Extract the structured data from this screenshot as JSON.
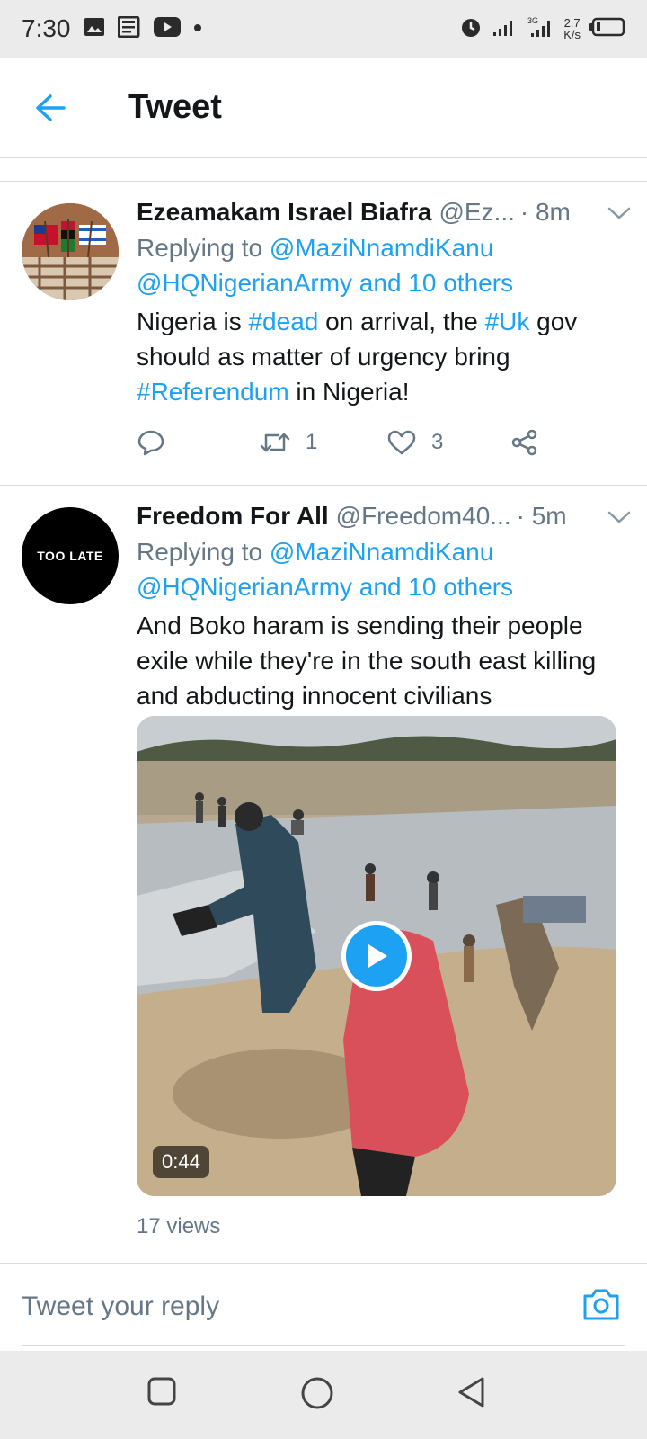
{
  "status_bar": {
    "time": "7:30",
    "net_speed_value": "2.7",
    "net_speed_unit": "K/s",
    "icons": [
      "image-icon",
      "news-icon",
      "youtube-icon",
      "dot-icon",
      "alarm-icon",
      "signal-icon",
      "signal-3g-icon",
      "battery-icon"
    ]
  },
  "header": {
    "title": "Tweet",
    "back_icon": "arrow-left-icon"
  },
  "colors": {
    "accent": "#1da1f2",
    "text_primary": "#14171a",
    "text_secondary": "#657786",
    "divider": "#d8dde2",
    "system_bar": "#ebebeb"
  },
  "tweets": [
    {
      "name": "Ezeamakam Israel Biafra",
      "handle": "@Ez...",
      "time": "· 8m",
      "replying_prefix": "Replying to ",
      "replying_user": "@MaziNnamdiKanu",
      "replying_rest": "@HQNigerianArmy and 10 others",
      "text_parts": [
        "Nigeria is ",
        "#dead",
        " on arrival, the ",
        "#Uk",
        " gov should as matter of urgency bring ",
        "#Referendum",
        " in Nigeria!"
      ],
      "retweets": "1",
      "likes": "3"
    },
    {
      "name": "Freedom For All",
      "handle": "@Freedom40...",
      "time": "· 5m",
      "avatar_text": "TOO LATE",
      "replying_prefix": "Replying to ",
      "replying_user": "@MaziNnamdiKanu",
      "replying_rest": "@HQNigerianArmy and 10 others",
      "text": "And Boko haram is sending their people exile while they're in the south east killing and abducting innocent civilians",
      "video_duration": "0:44",
      "views": "17 views"
    }
  ],
  "reply_bar": {
    "placeholder": "Tweet your reply",
    "camera_icon": "camera-icon"
  },
  "nav_bar": {
    "buttons": [
      "recents-square-icon",
      "home-circle-icon",
      "back-triangle-icon"
    ]
  }
}
